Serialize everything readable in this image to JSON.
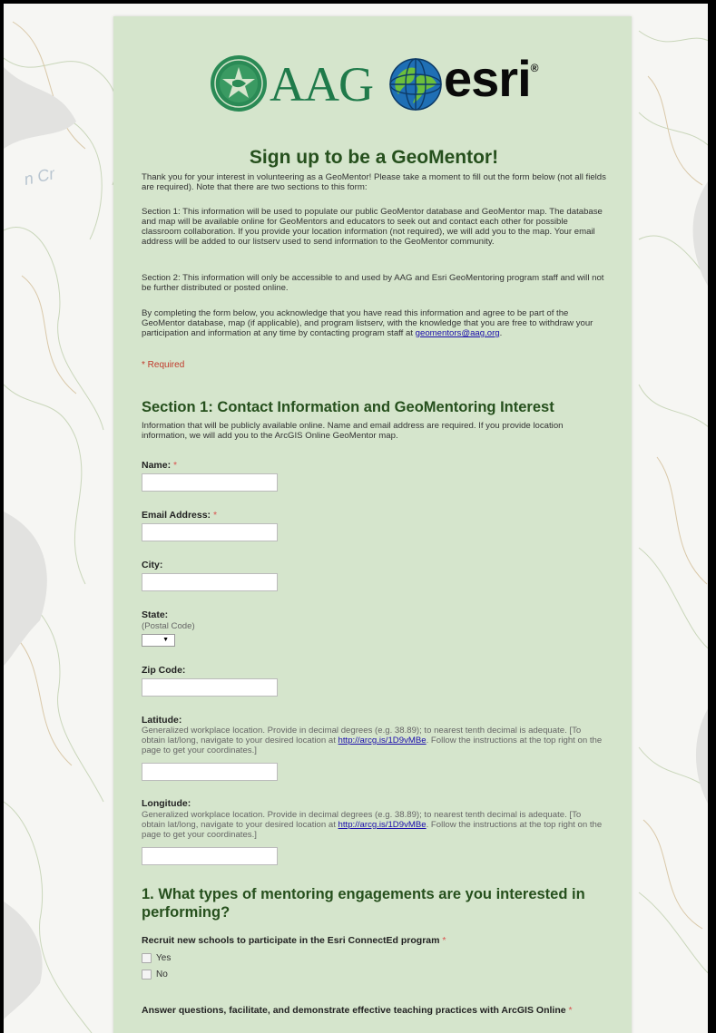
{
  "brand": {
    "aag_text": "AAG",
    "esri_text": "esri",
    "esri_mark": "®",
    "seal_icon": "aag-seal-icon",
    "globe_icon": "esri-globe-icon"
  },
  "title": "Sign up to be a GeoMentor!",
  "intro": {
    "p1": "Thank you for your interest in volunteering as a GeoMentor! Please take a moment to fill out the form below (not all fields are required). Note that there are two sections to this form:",
    "p2": "Section 1: This information will be used to populate our public GeoMentor database and GeoMentor map. The database and map will be available online for GeoMentors and educators to seek out and contact each other for possible classroom collaboration. If you provide your location information (not required), we will add you to the map. Your email address will be added to our listserv used to send information to the GeoMentor community.",
    "p3": "Section 2: This information will only be accessible to and used by AAG and Esri GeoMentoring program staff and will not be further distributed or posted online.",
    "p4": "By completing the form below, you acknowledge that you have read this information and agree to be part of the GeoMentor database, map (if applicable), and program listserv, with the knowledge that you are free to withdraw your participation and information at any time by contacting program staff at",
    "email_link": "geomentors@aag.org",
    "email_suffix": ".",
    "required_note": "* Required"
  },
  "section1": {
    "title": "Section 1: Contact Information and GeoMentoring Interest",
    "desc": "Information that will be publicly available online. Name and email address are required. If you provide location information, we will add you to the ArcGIS Online GeoMentor map."
  },
  "fields": {
    "name": {
      "label": "Name:",
      "required": "*",
      "value": ""
    },
    "email": {
      "label": "Email Address:",
      "required": "*",
      "value": ""
    },
    "city": {
      "label": "City:",
      "value": ""
    },
    "state": {
      "label": "State:",
      "help": "(Postal Code)",
      "selected": "▼"
    },
    "zip": {
      "label": "Zip Code:",
      "value": ""
    },
    "latitude": {
      "label": "Latitude:",
      "help_before": "Generalized workplace location. Provide in decimal degrees (e.g. 38.89); to nearest tenth decimal is adequate. [To obtain lat/long, navigate to your desired location at",
      "link": "http://arcg.is/1D9vMBe",
      "help_after": ". Follow the instructions at the top right on the page to get your coordinates.]",
      "value": ""
    },
    "longitude": {
      "label": "Longitude:",
      "help_before": "Generalized workplace location. Provide in decimal degrees (e.g. 38.89); to nearest tenth decimal is adequate. [To obtain lat/long, navigate to your desired location at",
      "link": "http://arcg.is/1D9vMBe",
      "help_after": ". Follow the instructions at the top right on the page to get your coordinates.]",
      "value": ""
    }
  },
  "question1": {
    "title": "1. What types of mentoring engagements are you interested in performing?",
    "items": [
      {
        "label": "Recruit new schools to participate in the Esri ConnectEd program",
        "required": "*",
        "options": [
          "Yes",
          "No"
        ]
      },
      {
        "label": "Answer questions, facilitate, and demonstrate effective teaching practices with ArcGIS Online",
        "required": "*",
        "options": []
      }
    ]
  }
}
